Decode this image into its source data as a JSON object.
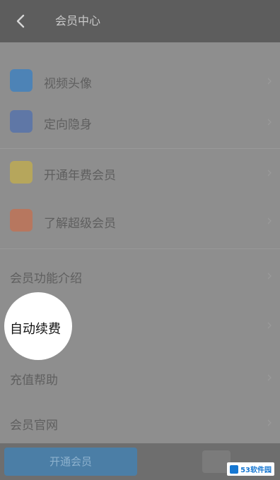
{
  "header": {
    "title": "会员中心",
    "back_icon": "chevron-left-icon"
  },
  "list": {
    "icon_rows": [
      {
        "label": "视频头像",
        "icon_color": "#4d83b6"
      },
      {
        "label": "定向隐身",
        "icon_color": "#5f77a6"
      },
      {
        "label": "开通年费会员",
        "icon_color": "#b6a65c"
      },
      {
        "label": "了解超级会员",
        "icon_color": "#b7775f"
      }
    ],
    "plain_rows": [
      {
        "label": "会员功能介绍"
      },
      {
        "label": "充值帮助"
      },
      {
        "label": "会员官网"
      }
    ]
  },
  "spotlight": {
    "label": "自动续费"
  },
  "bottom": {
    "open_button_label": "开通会员"
  },
  "watermark": {
    "text": "53软件园"
  }
}
